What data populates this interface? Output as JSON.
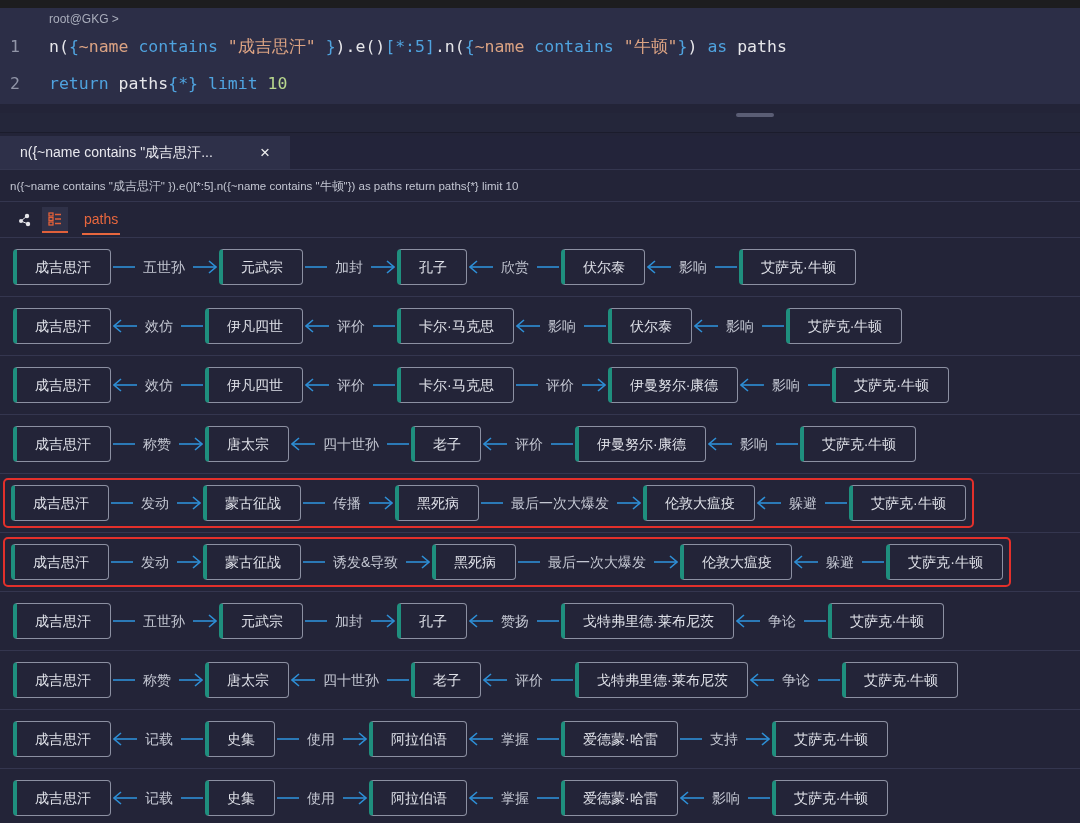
{
  "editor": {
    "prompt": "root@GKG >",
    "lines": [
      {
        "number": "1",
        "tokens": [
          {
            "kind": "plain",
            "text": "n("
          },
          {
            "kind": "keyword",
            "text": "{"
          },
          {
            "kind": "property",
            "text": "~name "
          },
          {
            "kind": "keyword",
            "text": "contains "
          },
          {
            "kind": "string",
            "text": "\"成吉思汗\" "
          },
          {
            "kind": "keyword",
            "text": "}"
          },
          {
            "kind": "plain",
            "text": ").e()"
          },
          {
            "kind": "keyword",
            "text": "[*:5]"
          },
          {
            "kind": "plain",
            "text": ".n("
          },
          {
            "kind": "keyword",
            "text": "{"
          },
          {
            "kind": "property",
            "text": "~name "
          },
          {
            "kind": "keyword",
            "text": "contains "
          },
          {
            "kind": "string",
            "text": "\"牛顿\""
          },
          {
            "kind": "keyword",
            "text": "}"
          },
          {
            "kind": "plain",
            "text": ") "
          },
          {
            "kind": "keyword",
            "text": "as"
          },
          {
            "kind": "plain",
            "text": " paths"
          }
        ]
      },
      {
        "number": "2",
        "tokens": [
          {
            "kind": "keyword",
            "text": "return"
          },
          {
            "kind": "plain",
            "text": " paths"
          },
          {
            "kind": "keyword",
            "text": "{*}"
          },
          {
            "kind": "keyword",
            "text": " limit "
          },
          {
            "kind": "number",
            "text": "10"
          }
        ]
      }
    ]
  },
  "query_tabs": [
    {
      "label": "n({~name contains \"成吉思汗...",
      "close": "×",
      "selected": true
    }
  ],
  "query_text": "n({~name contains \"成吉思汗\" }).e()[*:5].n({~name contains \"牛顿\"}) as paths return paths{*} limit 10",
  "views": [
    {
      "kind": "graph",
      "selected": false
    },
    {
      "kind": "table",
      "selected": true
    }
  ],
  "result_tabs": [
    {
      "label": "paths",
      "selected": true
    }
  ],
  "paths": [
    {
      "highlighted": false,
      "nodes": [
        "成吉思汗",
        "元武宗",
        "孔子",
        "伏尔泰",
        "艾萨克·牛顿"
      ],
      "edges": [
        {
          "label": "五世孙",
          "kind": "forward"
        },
        {
          "label": "加封",
          "kind": "forward"
        },
        {
          "label": "欣赏",
          "kind": "backward"
        },
        {
          "label": "影响",
          "kind": "backward"
        }
      ]
    },
    {
      "highlighted": false,
      "nodes": [
        "成吉思汗",
        "伊凡四世",
        "卡尔·马克思",
        "伏尔泰",
        "艾萨克·牛顿"
      ],
      "edges": [
        {
          "label": "效仿",
          "kind": "backward"
        },
        {
          "label": "评价",
          "kind": "backward"
        },
        {
          "label": "影响",
          "kind": "backward"
        },
        {
          "label": "影响",
          "kind": "backward"
        }
      ]
    },
    {
      "highlighted": false,
      "nodes": [
        "成吉思汗",
        "伊凡四世",
        "卡尔·马克思",
        "伊曼努尔·康德",
        "艾萨克·牛顿"
      ],
      "edges": [
        {
          "label": "效仿",
          "kind": "backward"
        },
        {
          "label": "评价",
          "kind": "backward"
        },
        {
          "label": "评价",
          "kind": "forward"
        },
        {
          "label": "影响",
          "kind": "backward"
        }
      ]
    },
    {
      "highlighted": false,
      "nodes": [
        "成吉思汗",
        "唐太宗",
        "老子",
        "伊曼努尔·康德",
        "艾萨克·牛顿"
      ],
      "edges": [
        {
          "label": "称赞",
          "kind": "forward"
        },
        {
          "label": "四十世孙",
          "kind": "backward"
        },
        {
          "label": "评价",
          "kind": "backward"
        },
        {
          "label": "影响",
          "kind": "backward"
        }
      ]
    },
    {
      "highlighted": true,
      "nodes": [
        "成吉思汗",
        "蒙古征战",
        "黑死病",
        "伦敦大瘟疫",
        "艾萨克·牛顿"
      ],
      "edges": [
        {
          "label": "发动",
          "kind": "forward"
        },
        {
          "label": "传播",
          "kind": "forward"
        },
        {
          "label": "最后一次大爆发",
          "kind": "forward"
        },
        {
          "label": "躲避",
          "kind": "backward"
        }
      ]
    },
    {
      "highlighted": true,
      "nodes": [
        "成吉思汗",
        "蒙古征战",
        "黑死病",
        "伦敦大瘟疫",
        "艾萨克·牛顿"
      ],
      "edges": [
        {
          "label": "发动",
          "kind": "forward"
        },
        {
          "label": "诱发&导致",
          "kind": "forward"
        },
        {
          "label": "最后一次大爆发",
          "kind": "forward"
        },
        {
          "label": "躲避",
          "kind": "backward"
        }
      ]
    },
    {
      "highlighted": false,
      "nodes": [
        "成吉思汗",
        "元武宗",
        "孔子",
        "戈特弗里德·莱布尼茨",
        "艾萨克·牛顿"
      ],
      "edges": [
        {
          "label": "五世孙",
          "kind": "forward"
        },
        {
          "label": "加封",
          "kind": "forward"
        },
        {
          "label": "赞扬",
          "kind": "backward"
        },
        {
          "label": "争论",
          "kind": "backward"
        }
      ]
    },
    {
      "highlighted": false,
      "nodes": [
        "成吉思汗",
        "唐太宗",
        "老子",
        "戈特弗里德·莱布尼茨",
        "艾萨克·牛顿"
      ],
      "edges": [
        {
          "label": "称赞",
          "kind": "forward"
        },
        {
          "label": "四十世孙",
          "kind": "backward"
        },
        {
          "label": "评价",
          "kind": "backward"
        },
        {
          "label": "争论",
          "kind": "backward"
        }
      ]
    },
    {
      "highlighted": false,
      "nodes": [
        "成吉思汗",
        "史集",
        "阿拉伯语",
        "爱德蒙·哈雷",
        "艾萨克·牛顿"
      ],
      "edges": [
        {
          "label": "记载",
          "kind": "backward"
        },
        {
          "label": "使用",
          "kind": "forward"
        },
        {
          "label": "掌握",
          "kind": "backward"
        },
        {
          "label": "支持",
          "kind": "forward"
        }
      ]
    },
    {
      "highlighted": false,
      "nodes": [
        "成吉思汗",
        "史集",
        "阿拉伯语",
        "爱德蒙·哈雷",
        "艾萨克·牛顿"
      ],
      "edges": [
        {
          "label": "记载",
          "kind": "backward"
        },
        {
          "label": "使用",
          "kind": "forward"
        },
        {
          "label": "掌握",
          "kind": "backward"
        },
        {
          "label": "影响",
          "kind": "backward"
        }
      ]
    }
  ]
}
